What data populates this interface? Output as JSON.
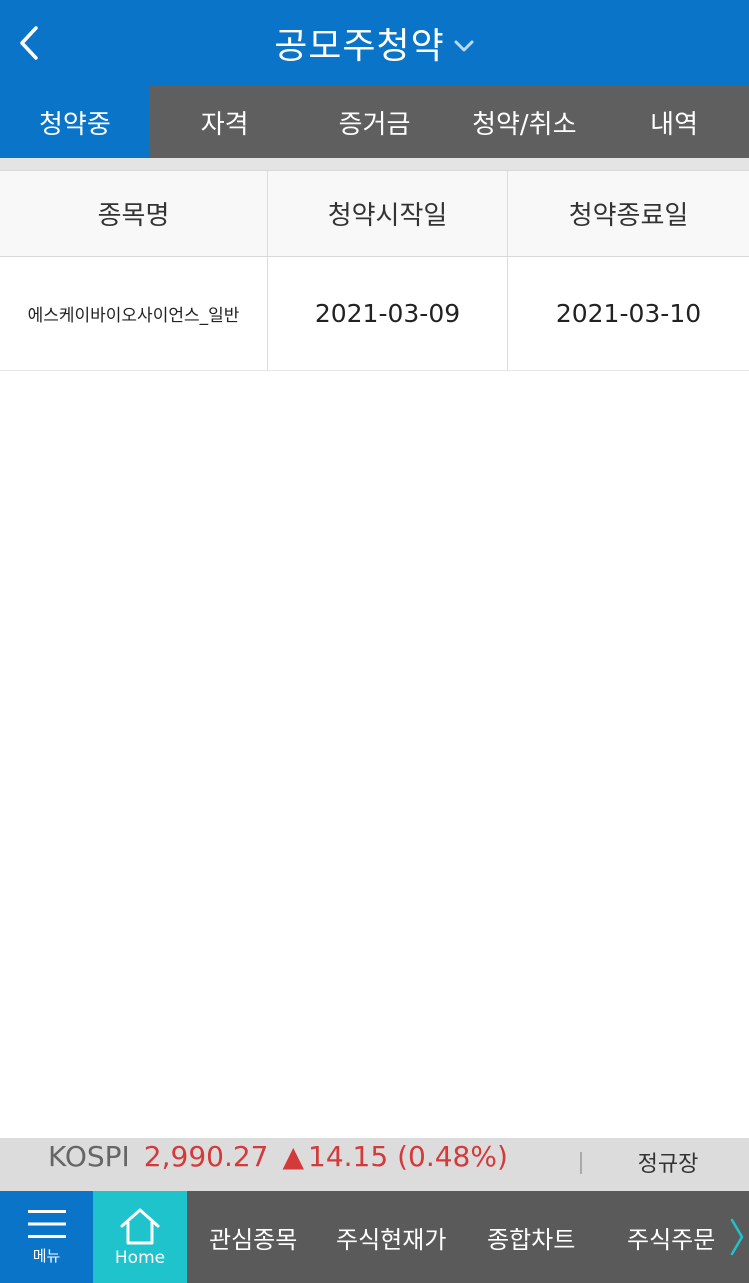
{
  "header": {
    "title": "공모주청약",
    "back_icon": "chevron-left-icon",
    "dropdown_icon": "chevron-down-icon"
  },
  "tabs": [
    {
      "label": "청약중",
      "active": true
    },
    {
      "label": "자격",
      "active": false
    },
    {
      "label": "증거금",
      "active": false
    },
    {
      "label": "청약/취소",
      "active": false
    },
    {
      "label": "내역",
      "active": false
    }
  ],
  "table": {
    "headers": [
      "종목명",
      "청약시작일",
      "청약종료일"
    ],
    "rows": [
      {
        "name": "에스케이바이오사이언스_일반",
        "start": "2021-03-09",
        "end": "2021-03-10"
      }
    ]
  },
  "ticker": {
    "index_name": "KOSPI",
    "value": "2,990.27",
    "change_symbol": "▲",
    "change": "14.15 (0.48%)",
    "session": "정규장"
  },
  "bottom_nav": {
    "menu_label": "메뉴",
    "home_label": "Home",
    "items": [
      "관심종목",
      "주식현재가",
      "종합차트",
      "주식주문"
    ],
    "more_icon": "chevron-right-icon"
  },
  "colors": {
    "primary": "#0a74c9",
    "tab_bg": "#5f5f5f",
    "home_accent": "#1fc3cc",
    "rise": "#d33a3a"
  }
}
